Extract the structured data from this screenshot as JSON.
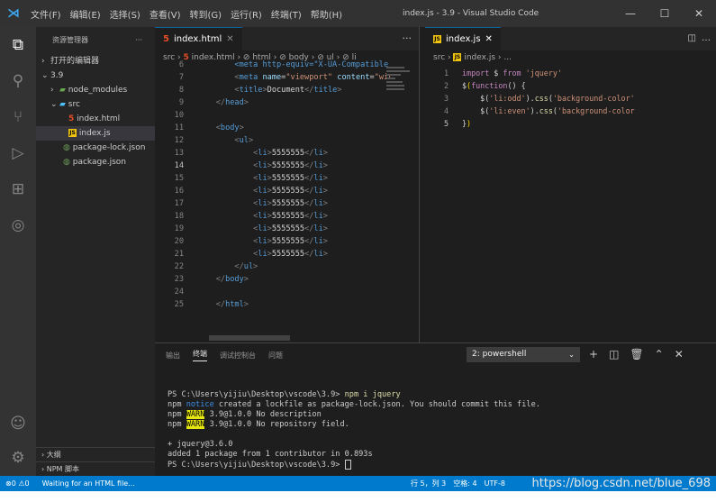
{
  "titlebar": {
    "menu": [
      "文件(F)",
      "编辑(E)",
      "选择(S)",
      "查看(V)",
      "转到(G)",
      "运行(R)",
      "终端(T)",
      "帮助(H)"
    ],
    "title": "index.js - 3.9 - Visual Studio Code"
  },
  "sidebar": {
    "header": "资源管理器",
    "more": "···",
    "open_editors": "打开的编辑器",
    "root": "3.9",
    "items": [
      "node_modules",
      "src",
      "index.html",
      "index.js",
      "package-lock.json",
      "package.json"
    ],
    "outline": "大纲",
    "npm_scripts": "NPM 脚本"
  },
  "editor_left": {
    "tab_label": "index.html",
    "breadcrumb": [
      "src",
      "index.html",
      "html",
      "body",
      "ul",
      "li"
    ],
    "lines": [
      {
        "n": "6",
        "type": "meta1"
      },
      {
        "n": "7",
        "type": "meta2"
      },
      {
        "n": "8",
        "type": "title",
        "text": "Document"
      },
      {
        "n": "9",
        "type": "close",
        "tag": "head",
        "indent": "    "
      },
      {
        "n": "10",
        "type": "blank"
      },
      {
        "n": "11",
        "type": "open",
        "tag": "body",
        "indent": "    "
      },
      {
        "n": "12",
        "type": "open",
        "tag": "ul",
        "indent": "        "
      },
      {
        "n": "13",
        "type": "li",
        "text": "5555555"
      },
      {
        "n": "14",
        "type": "li",
        "text": "5555555"
      },
      {
        "n": "15",
        "type": "li",
        "text": "5555555"
      },
      {
        "n": "16",
        "type": "li",
        "text": "5555555"
      },
      {
        "n": "17",
        "type": "li",
        "text": "5555555"
      },
      {
        "n": "18",
        "type": "li",
        "text": "5555555"
      },
      {
        "n": "19",
        "type": "li",
        "text": "5555555"
      },
      {
        "n": "20",
        "type": "li",
        "text": "5555555"
      },
      {
        "n": "21",
        "type": "li",
        "text": "5555555"
      },
      {
        "n": "22",
        "type": "close",
        "tag": "ul",
        "indent": "        "
      },
      {
        "n": "23",
        "type": "close",
        "tag": "body",
        "indent": "    "
      },
      {
        "n": "24",
        "type": "blank"
      },
      {
        "n": "25",
        "type": "close",
        "tag": "html",
        "indent": "    "
      }
    ],
    "meta1": "<meta http-equiv=\"X-UA-Compatible",
    "meta2_attr": "name",
    "meta2_val": "\"viewport\"",
    "meta2_attr2": "content",
    "meta2_rest": "\"wic"
  },
  "editor_right": {
    "tab_label": "index.js",
    "breadcrumb": [
      "src",
      "index.js",
      "..."
    ],
    "code": {
      "l1_kw": "import",
      "l1_var": " $ ",
      "l1_from": "from",
      "l1_str": " 'jquery'",
      "l2_fn": "function",
      "l3_sel": "'li:odd'",
      "l3_css": "css",
      "l3_prop": "'background-color'",
      "l4_sel": "'li:even'",
      "l4_css": "css",
      "l4_prop": "'background-color"
    }
  },
  "panel": {
    "tabs": [
      "输出",
      "终端",
      "调试控制台",
      "问题"
    ],
    "terminal_select": "2: powershell",
    "terminal": {
      "l1_prompt": "PS C:\\Users\\yijiu\\Desktop\\vscode\\3.9> ",
      "l1_cmd": "npm i jquery",
      "l2_a": "npm ",
      "l2_notice": "notice",
      "l2_b": " created a lockfile as package-lock.json. You should commit this file.",
      "l3_a": "npm ",
      "l3_warn": "WARN",
      "l3_b": " 3.9@1.0.0 No description",
      "l4_a": "npm ",
      "l4_warn": "WARN",
      "l4_b": " 3.9@1.0.0 No repository field.",
      "l5": "+ jquery@3.6.0",
      "l6": "added 1 package from 1 contributor in 0.893s",
      "l7_prompt": "PS C:\\Users\\yijiu\\Desktop\\vscode\\3.9> "
    }
  },
  "statusbar": {
    "problems": "⊗0 ⚠0",
    "message": "Waiting for an HTML file...",
    "position": "行 5，列 3",
    "spaces": "空格: 4",
    "encoding": "UTF-8",
    "watermark": "https://blog.csdn.net/blue_698"
  }
}
